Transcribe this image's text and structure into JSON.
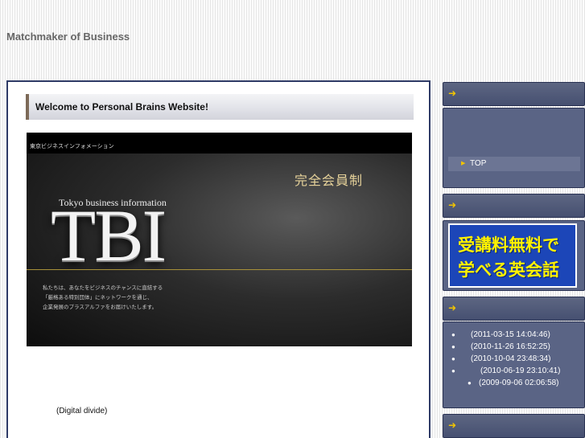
{
  "site": {
    "title": "Matchmaker of Business"
  },
  "main": {
    "welcome": "Welcome to Personal Brains Website!",
    "banner": {
      "small_text": "東京ビジネスインフォメーション",
      "membership": "完全会員制",
      "tokyo": "Tokyo business information",
      "logo": "TBI",
      "description": [
        "私たちは、あなたをビジネスのチャンスに直結する",
        "「厳格ある特別団体」にネットワークを通じ、",
        "企業発展のプラスアルファをお届けいたします。"
      ]
    },
    "digital_divide": "(Digital divide)"
  },
  "sidebar": {
    "arrow_glyph": "➜",
    "nav": {
      "top_label": "TOP"
    },
    "ad": {
      "line1": "受講料無料で",
      "line2": "学べる英会話"
    },
    "recent_posts": [
      "(2011-03-15 14:04:46)",
      "(2010-11-26 16:52:25)",
      "(2010-10-04 23:48:34)",
      "(2010-06-19 23:10:41)",
      "(2009-09-06 02:06:58)"
    ]
  },
  "colors": {
    "accent": "#f2c400",
    "panel": "#5a6485",
    "border": "#2e3a66"
  }
}
